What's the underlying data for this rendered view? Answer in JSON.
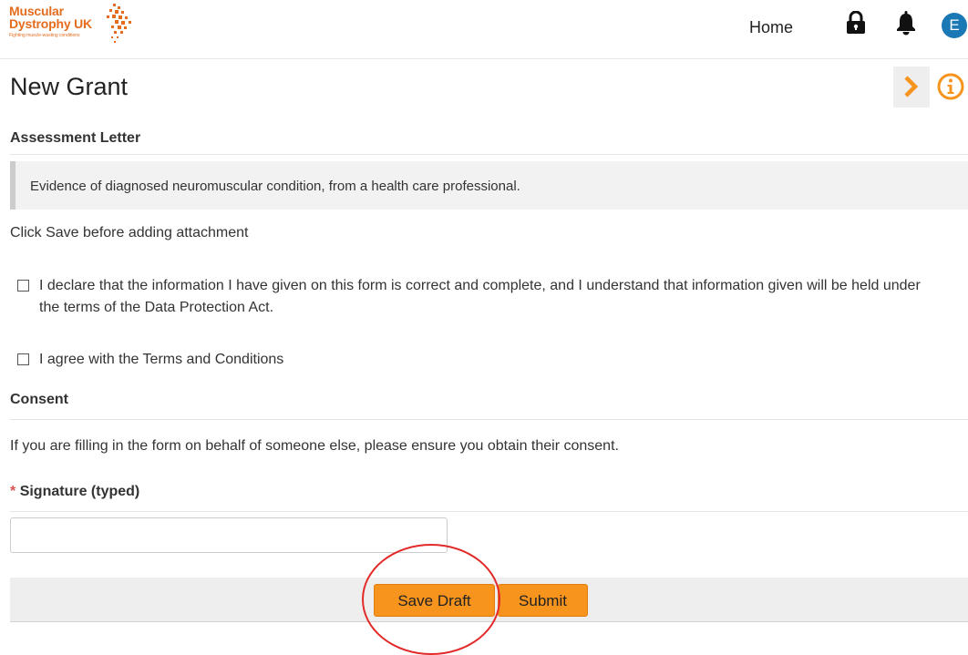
{
  "header": {
    "logo_line1": "Muscular",
    "logo_line2": "Dystrophy UK",
    "logo_tagline": "Fighting muscle-wasting conditions",
    "nav_home": "Home",
    "avatar_initial": "E",
    "lock_icon": "lock-icon",
    "bell_icon": "bell-icon",
    "brand_color": "#e36c1e",
    "avatar_color": "#1a78b4"
  },
  "page": {
    "title": "New Grant",
    "side_toggle_icon": "chevron-right-icon",
    "info_icon": "info-icon"
  },
  "assessment": {
    "heading": "Assessment Letter",
    "evidence_text": "Evidence of diagnosed neuromuscular condition, from a health care professional.",
    "note": "Click Save before adding attachment"
  },
  "declarations": {
    "declare_label": "I declare that the information I have given on this form is correct and complete, and I understand that information given will be held under the terms of the Data Protection Act.",
    "declare_checked": false,
    "terms_label": "I agree with the Terms and Conditions",
    "terms_checked": false
  },
  "consent": {
    "heading": "Consent",
    "text": "If you are filling in the form on behalf of someone else, please ensure you obtain their consent."
  },
  "signature": {
    "required_marker": "*",
    "label": "Signature (typed)",
    "value": ""
  },
  "actions": {
    "save_draft_label": "Save Draft",
    "submit_label": "Submit",
    "button_color": "#f7941d",
    "annotation_color": "#e32a2a"
  }
}
